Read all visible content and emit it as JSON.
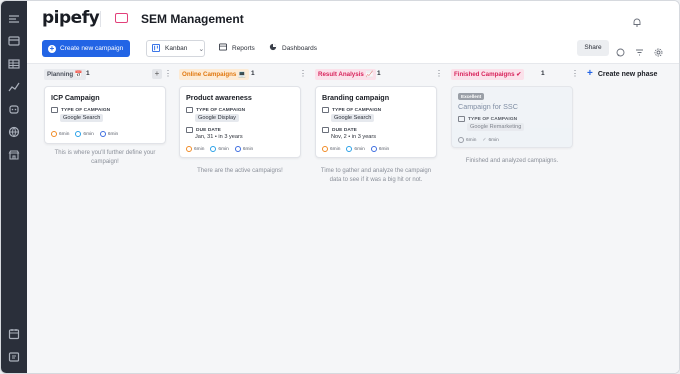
{
  "app": {
    "logo": "pipefy",
    "pipe_title": "SEM Management"
  },
  "toolbar": {
    "create_label": "Create new campaign",
    "view_label": "Kanban",
    "reports_label": "Reports",
    "dashboards_label": "Dashboards",
    "share_label": "Share"
  },
  "board": {
    "new_phase_label": "Create new phase",
    "phases": [
      {
        "name": "Planning 📅",
        "count": "1",
        "tag_bg": "#e8eaee",
        "tag_color": "#4a4f5a",
        "description": "This is where you'll further define your campaign!",
        "card": {
          "title": "ICP Campaign",
          "type_label": "TYPE OF CAMPAIGN",
          "type_value": "Google Search",
          "timers": [
            "6min",
            "6min",
            "6min"
          ]
        }
      },
      {
        "name": "Online Campaigns 💻",
        "count": "1",
        "tag_bg": "#fdebd5",
        "tag_color": "#e0780f",
        "description": "There are the active campaigns!",
        "card": {
          "title": "Product awareness",
          "type_label": "TYPE OF CAMPAIGN",
          "type_value": "Google Display",
          "due_label": "DUE DATE",
          "due_value": "Jan, 31 • in 3 years",
          "timers": [
            "6min",
            "6min",
            "6min"
          ]
        }
      },
      {
        "name": "Result Analysis 📈",
        "count": "1",
        "tag_bg": "#fbe1ea",
        "tag_color": "#d8245c",
        "description": "Time to gather and analyze the campaign data to see if it was a big hit or not.",
        "card": {
          "title": "Branding campaign",
          "type_label": "TYPE OF CAMPAIGN",
          "type_value": "Google Search",
          "due_label": "DUE DATE",
          "due_value": "Nov, 2 • in 3 years",
          "timers": [
            "6min",
            "6min",
            "6min"
          ]
        }
      },
      {
        "name": "Finished Campaigns ✔",
        "count": "1",
        "tag_bg": "#fbe1ea",
        "tag_color": "#d8245c",
        "description": "Finished and analyzed campaigns.",
        "card": {
          "badge": "Excellent",
          "title": "Campaign for SSC",
          "type_label": "TYPE OF CAMPAIGN",
          "type_value": "Google Remarketing",
          "timers": [
            "6min",
            "6min"
          ]
        }
      }
    ]
  }
}
